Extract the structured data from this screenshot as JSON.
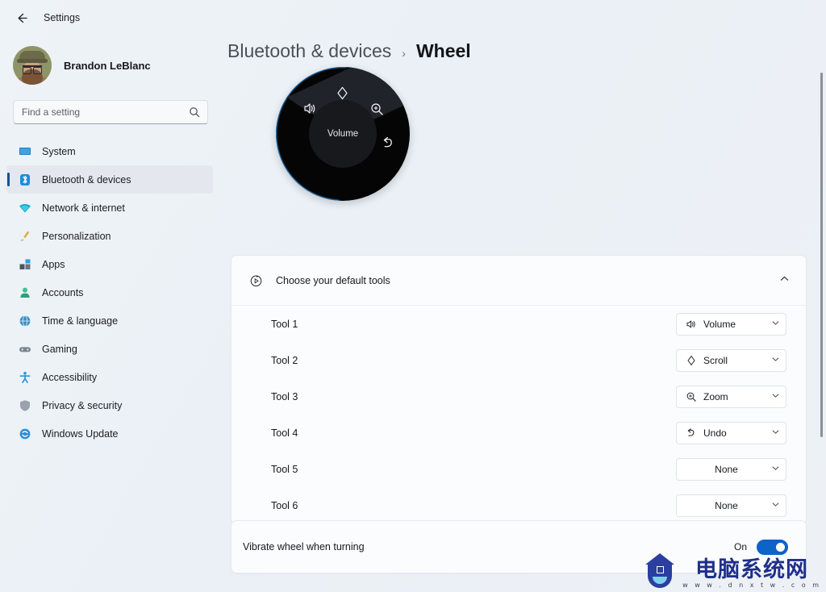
{
  "window": {
    "back_label": "back-arrow",
    "title": "Settings"
  },
  "account": {
    "name": "Brandon LeBlanc"
  },
  "search": {
    "placeholder": "Find a setting",
    "value": "",
    "icon": "search-icon"
  },
  "sidebar": {
    "items": [
      {
        "label": "System",
        "icon": "monitor-icon",
        "selected": false
      },
      {
        "label": "Bluetooth & devices",
        "icon": "bluetooth-icon",
        "selected": true
      },
      {
        "label": "Network & internet",
        "icon": "wifi-icon",
        "selected": false
      },
      {
        "label": "Personalization",
        "icon": "paintbrush-icon",
        "selected": false
      },
      {
        "label": "Apps",
        "icon": "apps-grid-icon",
        "selected": false
      },
      {
        "label": "Accounts",
        "icon": "person-icon",
        "selected": false
      },
      {
        "label": "Time & language",
        "icon": "globe-clock-icon",
        "selected": false
      },
      {
        "label": "Gaming",
        "icon": "gamepad-icon",
        "selected": false
      },
      {
        "label": "Accessibility",
        "icon": "accessibility-person-icon",
        "selected": false
      },
      {
        "label": "Privacy & security",
        "icon": "shield-icon",
        "selected": false
      },
      {
        "label": "Windows Update",
        "icon": "refresh-circle-icon",
        "selected": false
      }
    ]
  },
  "breadcrumb": {
    "parent": "Bluetooth & devices",
    "separator": "›",
    "current": "Wheel"
  },
  "wheel": {
    "hub_label": "Volume",
    "icons": {
      "top": "scroll-diamond-icon",
      "left": "volume-speaker-icon",
      "right": "zoom-magnifier-icon",
      "bottom_right": "undo-arrow-icon"
    },
    "accent_color": "#1f7fd0",
    "body_color": "#050505"
  },
  "tools_card": {
    "icon": "wheel-dial-icon",
    "title": "Choose your default tools",
    "expand_icon": "chevron-up-icon",
    "expanded": true,
    "rows": [
      {
        "label": "Tool 1",
        "value": "Volume",
        "icon": "volume-speaker-icon"
      },
      {
        "label": "Tool 2",
        "value": "Scroll",
        "icon": "scroll-diamond-icon"
      },
      {
        "label": "Tool 3",
        "value": "Zoom",
        "icon": "zoom-magnifier-icon"
      },
      {
        "label": "Tool 4",
        "value": "Undo",
        "icon": "undo-arrow-icon"
      },
      {
        "label": "Tool 5",
        "value": "None",
        "icon": ""
      },
      {
        "label": "Tool 6",
        "value": "None",
        "icon": ""
      }
    ],
    "chevron_icon": "chevron-down-icon"
  },
  "vibrate_card": {
    "label": "Vibrate wheel when turning",
    "state_text": "On",
    "enabled": true,
    "accent_color": "#0d63c8"
  },
  "watermark": {
    "title": "电脑系统网",
    "url": "w w w . d n x t w . c o m"
  }
}
